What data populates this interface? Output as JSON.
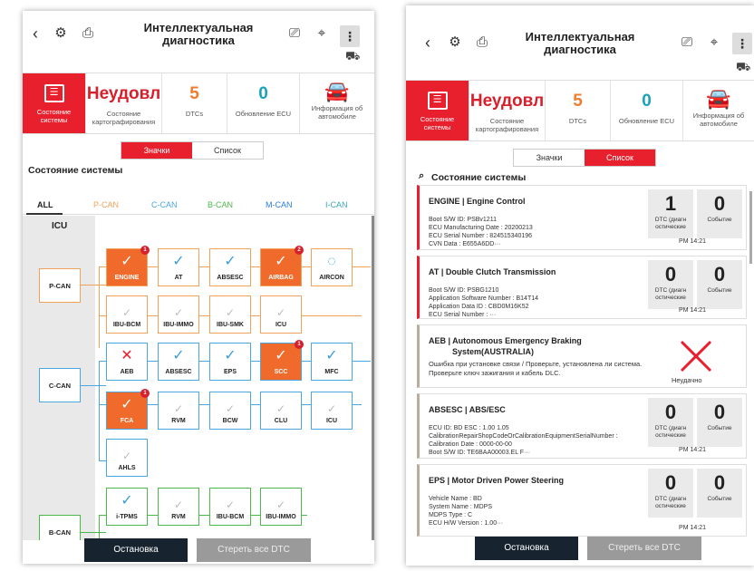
{
  "header": {
    "title_line1": "Интеллектуальная",
    "title_line2": "диагностика",
    "back_icon": "‹",
    "menu_icon": "⋮"
  },
  "summary": {
    "system_status_label": "Состояние системы",
    "result_value": "Неудовл",
    "result_label": "Состояние картографирования",
    "dtc_value": "5",
    "dtc_label": "DTCs",
    "ecu_update_value": "0",
    "ecu_update_label": "Обновление ECU",
    "vehicle_info_label": "Информация об автомобиле"
  },
  "view_toggle": {
    "icons_label": "Значки",
    "list_label": "Список"
  },
  "section_title": "Состояние системы",
  "tabs": [
    "ALL",
    "P-CAN",
    "C-CAN",
    "B-CAN",
    "M-CAN",
    "I-CAN"
  ],
  "colors": {
    "accent_red": "#e8202e",
    "fault_orange": "#f06b2b",
    "pcan": "#f1a25a",
    "ccan": "#4aa7e0",
    "bcan": "#4db84a",
    "mcan": "#2a7fd8",
    "ican": "#3aa8b5"
  },
  "diagram": {
    "gateway_label": "ICU",
    "buses": [
      "P-CAN",
      "C-CAN",
      "B-CAN"
    ],
    "pcan_row1": [
      {
        "label": "ENGINE",
        "state": "fault",
        "badge": "1"
      },
      {
        "label": "AT",
        "state": "ok"
      },
      {
        "label": "ABSESC",
        "state": "ok"
      },
      {
        "label": "AIRBAG",
        "state": "fault",
        "badge": "2"
      },
      {
        "label": "AIRCON",
        "state": "loading"
      }
    ],
    "pcan_row2": [
      {
        "label": "IBU-BCM",
        "state": "dim"
      },
      {
        "label": "IBU-IMMO",
        "state": "dim"
      },
      {
        "label": "IBU-SMK",
        "state": "dim"
      },
      {
        "label": "ICU",
        "state": "dim"
      }
    ],
    "ccan_row1": [
      {
        "label": "AEB",
        "state": "x"
      },
      {
        "label": "ABSESC",
        "state": "ok"
      },
      {
        "label": "EPS",
        "state": "ok"
      },
      {
        "label": "SCC",
        "state": "fault",
        "badge": "1"
      },
      {
        "label": "MFC",
        "state": "ok"
      }
    ],
    "ccan_row2": [
      {
        "label": "FCA",
        "state": "fault",
        "badge": "1"
      },
      {
        "label": "RVM",
        "state": "dim"
      },
      {
        "label": "BCW",
        "state": "dim"
      },
      {
        "label": "CLU",
        "state": "dim"
      },
      {
        "label": "ICU",
        "state": "dim"
      }
    ],
    "ccan_row3": [
      {
        "label": "AHLS",
        "state": "dim"
      }
    ],
    "bcan_row1": [
      {
        "label": "i-TPMS",
        "state": "ok"
      },
      {
        "label": "RVM",
        "state": "dim"
      },
      {
        "label": "IBU-BCM",
        "state": "dim"
      },
      {
        "label": "IBU-IMMO",
        "state": "dim"
      }
    ]
  },
  "buttons": {
    "stop": "Остановка",
    "clear_all": "Стереть все DTC"
  },
  "cards": [
    {
      "title": "ENGINE | Engine Control",
      "lines": [
        "Boot S/W ID: PSBv1211",
        "ECU Manufacturing Date : 20200213",
        "ECU Serial Number : 824515340196",
        "CVN Data : E655A6DD···"
      ],
      "dtc": "1",
      "dtc_label": "DTC (диагн остические",
      "events": "0",
      "events_label": "Событие",
      "time": "PM 14:21"
    },
    {
      "title": "AT | Double Clutch Transmission",
      "lines": [
        "Boot S/W ID: PSBG1210",
        "Application Software Number : B14T14",
        "Application Data ID : CBD0M16K52",
        "ECU Serial Number : ···"
      ],
      "dtc": "0",
      "dtc_label": "DTC (диагн остические",
      "events": "0",
      "events_label": "Событие",
      "time": "PM 14:21"
    },
    {
      "title": "AEB | Autonomous Emergency Braking",
      "title2": "System(AUSTRALIA)",
      "desc": "Ошибка при установке связи / Проверьте, установлена ли система. Проверьте ключ зажигания и кабель DLC.",
      "status": "Неудачно"
    },
    {
      "title": "ABSESC | ABS/ESC",
      "lines": [
        "ECU ID: BD ESC : 1.00 1.05",
        "CalibrationRepairShopCodeOrCalibrationEquipmentSerialNumber :",
        "Calibration Date : 0000-00-00",
        "Boot S/W ID: TE6BAA00003.EL F···"
      ],
      "dtc": "0",
      "dtc_label": "DTC (диагн остические",
      "events": "0",
      "events_label": "Событие",
      "time": "PM 14:21"
    },
    {
      "title": "EPS | Motor Driven Power Steering",
      "lines": [
        "Vehicle Name : BD",
        "System Name : MDPS",
        "MDPS Type : C",
        "ECU H/W Version : 1.00···"
      ],
      "dtc": "0",
      "dtc_label": "DTC (диагн остические",
      "events": "0",
      "events_label": "Событие",
      "time": "PM 14:21"
    }
  ]
}
